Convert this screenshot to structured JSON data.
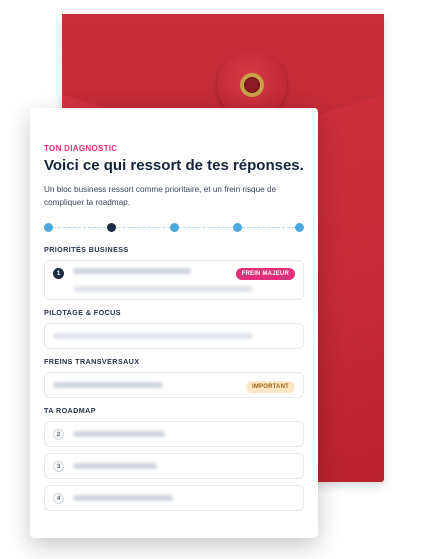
{
  "card": {
    "eyebrow": "TON DIAGNOSTIC",
    "title": "Voici ce qui ressort de tes réponses.",
    "subtitle": "Un bloc business ressort comme prioritaire, et un frein risque de compliquer ta roadmap."
  },
  "stepper": {
    "steps": 5,
    "active_step": 2
  },
  "sections": {
    "priorities": {
      "label": "PRIORITÉS BUSINESS",
      "item_number": "1",
      "badge": "FREIN MAJEUR"
    },
    "pilotage": {
      "label": "PILOTAGE & FOCUS"
    },
    "freins": {
      "label": "FREINS TRANSVERSAUX",
      "badge": "IMPORTANT"
    },
    "roadmap": {
      "label": "TA ROADMAP",
      "items": [
        {
          "number": "2"
        },
        {
          "number": "3"
        },
        {
          "number": "4"
        }
      ]
    }
  },
  "colors": {
    "accent_pink": "#e0307a",
    "step_blue": "#4fa8dc",
    "step_active": "#1c2c44",
    "envelope_red": "#c92b37"
  }
}
